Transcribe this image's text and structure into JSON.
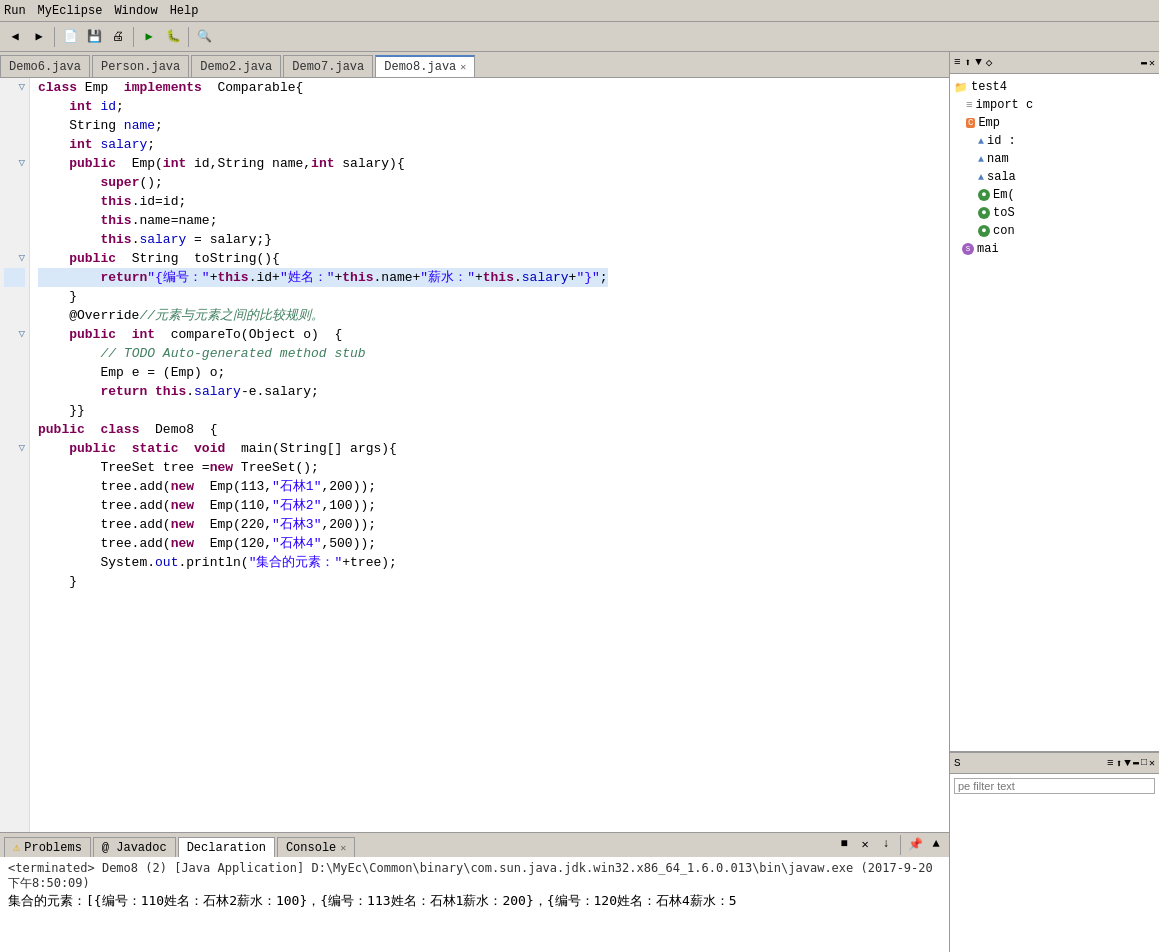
{
  "menubar": {
    "items": [
      "Run",
      "MyEclipse",
      "Window",
      "Help"
    ]
  },
  "tabs": [
    {
      "label": "Demo6.java",
      "active": false
    },
    {
      "label": "Person.java",
      "active": false
    },
    {
      "label": "Demo2.java",
      "active": false
    },
    {
      "label": "Demo7.java",
      "active": false
    },
    {
      "label": "Demo8.java",
      "active": true,
      "closeable": true
    }
  ],
  "code_lines": [
    {
      "num": "",
      "text": "class Emp  implements  Comparable{",
      "indent": 0
    },
    {
      "num": "",
      "text": "    int id;",
      "indent": 0
    },
    {
      "num": "",
      "text": "    String name;",
      "indent": 0
    },
    {
      "num": "",
      "text": "    int salary;",
      "indent": 0
    },
    {
      "num": "",
      "text": "    public  Emp(int id,String name,int salary){",
      "indent": 0
    },
    {
      "num": "",
      "text": "        super();",
      "indent": 0
    },
    {
      "num": "",
      "text": "        this.id=id;",
      "indent": 0
    },
    {
      "num": "",
      "text": "        this.name=name;",
      "indent": 0
    },
    {
      "num": "",
      "text": "        this.salary = salary;}",
      "indent": 0
    },
    {
      "num": "",
      "text": "    public  String  toString(){",
      "indent": 0
    },
    {
      "num": "",
      "text": "        return\"{编号：\"+this.id+\"姓名：\"+this.name+\"薪水：\"+this.salary+\"}\";",
      "indent": 0
    },
    {
      "num": "",
      "text": "    }",
      "indent": 0
    },
    {
      "num": "",
      "text": "    @Override//元素与元素之间的比较规则。",
      "indent": 0
    },
    {
      "num": "",
      "text": "    public  int  compareTo(Object o)  {",
      "indent": 0
    },
    {
      "num": "",
      "text": "        // TODO Auto-generated method stub",
      "indent": 0
    },
    {
      "num": "",
      "text": "        Emp e = (Emp) o;",
      "indent": 0
    },
    {
      "num": "",
      "text": "        return this.salary-e.salary;",
      "indent": 0
    },
    {
      "num": "",
      "text": "    }}",
      "indent": 0
    },
    {
      "num": "",
      "text": "public  class  Demo8  {",
      "indent": 0
    },
    {
      "num": "",
      "text": "    public  static  void  main(String[] args){",
      "indent": 0
    },
    {
      "num": "",
      "text": "        TreeSet tree =new TreeSet();",
      "indent": 0
    },
    {
      "num": "",
      "text": "        tree.add(new  Emp(113,\"石林1\",200));",
      "indent": 0
    },
    {
      "num": "",
      "text": "        tree.add(new  Emp(110,\"石林2\",100));",
      "indent": 0
    },
    {
      "num": "",
      "text": "        tree.add(new  Emp(220,\"石林3\",200));",
      "indent": 0
    },
    {
      "num": "",
      "text": "        tree.add(new  Emp(120,\"石林4\",500));",
      "indent": 0
    },
    {
      "num": "",
      "text": "        System.out.println(\"集合的元素：\"+tree);",
      "indent": 0
    },
    {
      "num": "",
      "text": "    }",
      "indent": 0
    }
  ],
  "outline": {
    "title": "S",
    "filter_placeholder": "pe filter text",
    "items": [
      {
        "label": "test4",
        "icon": "folder",
        "level": 0
      },
      {
        "label": "import c",
        "icon": "import",
        "level": 0
      },
      {
        "label": "Emp",
        "icon": "class",
        "level": 0
      },
      {
        "label": "id :",
        "icon": "field",
        "level": 1
      },
      {
        "label": "nam",
        "icon": "field",
        "level": 1
      },
      {
        "label": "sala",
        "icon": "field",
        "level": 1
      },
      {
        "label": "Em(",
        "icon": "method-green",
        "level": 1
      },
      {
        "label": "toS",
        "icon": "method-green",
        "level": 1
      },
      {
        "label": "con",
        "icon": "method-green",
        "level": 1
      },
      {
        "label": "mai",
        "icon": "method-special",
        "level": 0
      }
    ]
  },
  "bottom_tabs": [
    {
      "label": "Problems",
      "icon": "warning"
    },
    {
      "label": "@ Javadoc",
      "icon": "javadoc"
    },
    {
      "label": "Declaration",
      "active": true
    },
    {
      "label": "Console",
      "icon": "console"
    }
  ],
  "console": {
    "terminated": "<terminated> Demo8 (2) [Java Application] D:\\MyEc\\Common\\binary\\com.sun.java.jdk.win32.x86_64_1.6.0.013\\bin\\javaw.exe (2017-9-20 下午8:50:09)",
    "output": "集合的元素：[{编号：110姓名：石林2薪水：100}，{编号：113姓名：石林1薪水：200}，{编号：120姓名：石林4薪水：5"
  }
}
